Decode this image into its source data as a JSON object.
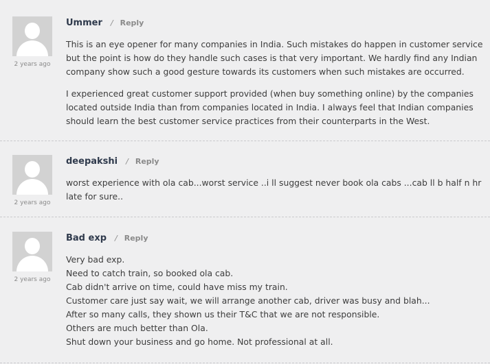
{
  "comments": [
    {
      "author": "Ummer",
      "separator": "/",
      "reply_label": "Reply",
      "time": "2 years ago",
      "paragraphs": [
        "This is an eye opener for many companies in India. Such mistakes do happen in customer service but the point is how do they handle such cases is that very important. We hardly find any Indian company show such a good gesture towards its customers when such mistakes are occurred.",
        "I experienced great customer support provided (when buy something online) by the companies located outside India than from companies located in India. I always feel that Indian companies should learn the best customer service practices from their counterparts in the West."
      ]
    },
    {
      "author": "deepakshi",
      "separator": "/",
      "reply_label": "Reply",
      "time": "2 years ago",
      "paragraphs": [
        "worst experience with ola cab...worst service ..i ll suggest never book ola cabs ...cab ll b half n hr late for sure.."
      ]
    },
    {
      "author": "Bad exp",
      "separator": "/",
      "reply_label": "Reply",
      "time": "2 years ago",
      "lines": [
        "Very bad exp.",
        "Need to catch train, so booked ola cab.",
        "Cab didn't arrive on time, could have miss my train.",
        "Customer care just say wait, we will arrange another cab, driver was busy and blah...",
        "After so many calls, they shown us their T&C that we are not responsible.",
        "Others are much better than Ola.",
        "Shut down your business and go home. Not professional at all."
      ]
    }
  ]
}
